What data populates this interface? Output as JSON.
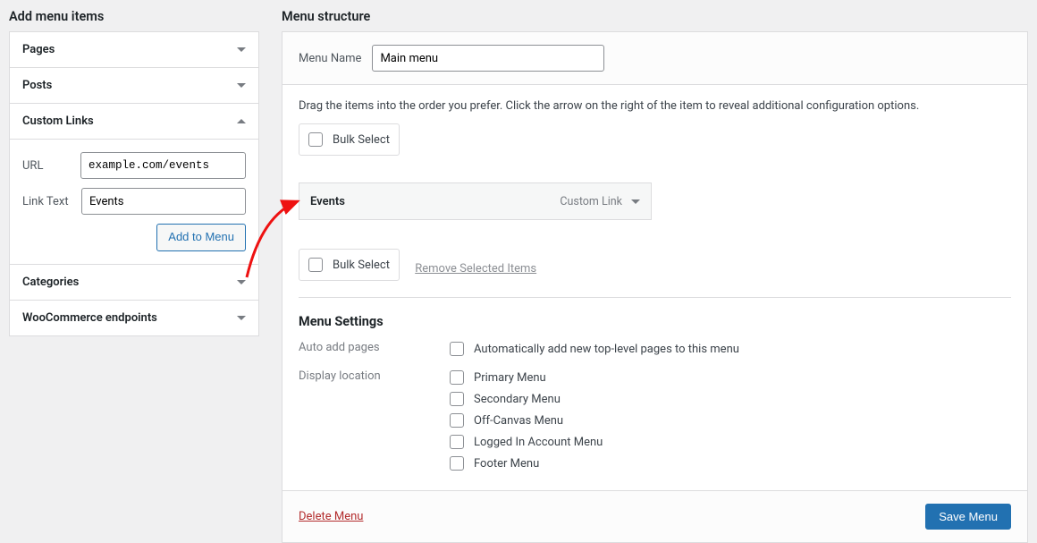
{
  "left": {
    "heading": "Add menu items",
    "sections": {
      "pages": "Pages",
      "posts": "Posts",
      "custom_links": "Custom Links",
      "categories": "Categories",
      "woocommerce": "WooCommerce endpoints"
    },
    "custom_links": {
      "url_label": "URL",
      "url_value": "example.com/events",
      "text_label": "Link Text",
      "text_value": "Events",
      "add_button": "Add to Menu"
    }
  },
  "right": {
    "heading": "Menu structure",
    "menu_name_label": "Menu Name",
    "menu_name_value": "Main menu",
    "help_text": "Drag the items into the order you prefer. Click the arrow on the right of the item to reveal additional configuration options.",
    "bulk_select": "Bulk Select",
    "remove_selected": "Remove Selected Items",
    "menu_item": {
      "title": "Events",
      "type": "Custom Link"
    },
    "settings": {
      "heading": "Menu Settings",
      "auto_add_label": "Auto add pages",
      "auto_add_text": "Automatically add new top-level pages to this menu",
      "display_label": "Display location",
      "locations": [
        "Primary Menu",
        "Secondary Menu",
        "Off-Canvas Menu",
        "Logged In Account Menu",
        "Footer Menu"
      ]
    },
    "delete": "Delete Menu",
    "save": "Save Menu"
  }
}
